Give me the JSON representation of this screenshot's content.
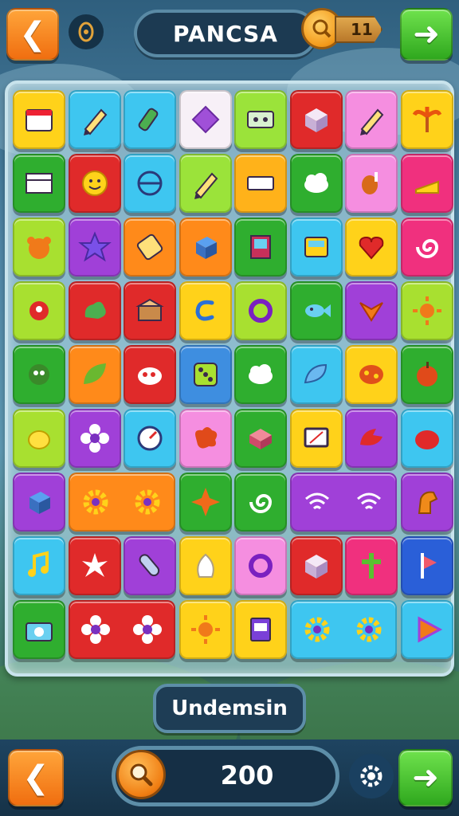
{
  "header": {
    "title": "PANCSA",
    "coin_count": "11",
    "back_icon": "arrow-left-icon",
    "next_icon": "arrow-right-icon",
    "badge_icon": "ornament-badge-icon"
  },
  "board": {
    "tiles": [
      {
        "icon": "calendar-icon",
        "color": "#ffd21a"
      },
      {
        "icon": "pencil-icon",
        "color": "#3ec6f0"
      },
      {
        "icon": "marker-icon",
        "color": "#3ec6f0"
      },
      {
        "icon": "diamond-icon",
        "color": "#f7f0f7"
      },
      {
        "icon": "cassette-icon",
        "color": "#9be33a"
      },
      {
        "icon": "box-icon",
        "color": "#e02a2a"
      },
      {
        "icon": "pencil-icon",
        "color": "#f58ee0"
      },
      {
        "icon": "palm-tree-icon",
        "color": "#ffd21a"
      },
      {
        "icon": "window-icon",
        "color": "#2fae2f"
      },
      {
        "icon": "smiley-icon",
        "color": "#e02a2a"
      },
      {
        "icon": "fan-icon",
        "color": "#3ec6f0"
      },
      {
        "icon": "pencil-icon",
        "color": "#9be33a"
      },
      {
        "icon": "ticket-icon",
        "color": "#ffb21a"
      },
      {
        "icon": "cloud-icon",
        "color": "#2fae2f"
      },
      {
        "icon": "drumstick-icon",
        "color": "#f58ee0"
      },
      {
        "icon": "cheese-icon",
        "color": "#f0307e"
      },
      {
        "icon": "bear-icon",
        "color": "#a8e030"
      },
      {
        "icon": "star-icon",
        "color": "#a040d8"
      },
      {
        "icon": "battery-icon",
        "color": "#ff8a1a"
      },
      {
        "icon": "cube-icon",
        "color": "#ff8a1a"
      },
      {
        "icon": "book-icon",
        "color": "#2fae2f"
      },
      {
        "icon": "radio-icon",
        "color": "#3ec6f0"
      },
      {
        "icon": "heart-icon",
        "color": "#ffd21a"
      },
      {
        "icon": "swirl-icon",
        "color": "#f0307e"
      },
      {
        "icon": "bird-icon",
        "color": "#a8e030"
      },
      {
        "icon": "blob-icon",
        "color": "#e02a2a"
      },
      {
        "icon": "treasure-icon",
        "color": "#e02a2a"
      },
      {
        "icon": "spiral-icon",
        "color": "#ffd21a"
      },
      {
        "icon": "ring-icon",
        "color": "#a8e030"
      },
      {
        "icon": "fish-icon",
        "color": "#2fae2f"
      },
      {
        "icon": "phoenix-icon",
        "color": "#a040d8"
      },
      {
        "icon": "sun-icon",
        "color": "#a8e030"
      },
      {
        "icon": "monster-icon",
        "color": "#2fae2f"
      },
      {
        "icon": "leaf-icon",
        "color": "#ff8a1a"
      },
      {
        "icon": "cloud-dots-icon",
        "color": "#e02a2a"
      },
      {
        "icon": "dice-icon",
        "color": "#3e8ee0"
      },
      {
        "icon": "cloud-icon",
        "color": "#2fae2f"
      },
      {
        "icon": "shell-icon",
        "color": "#3ec6f0"
      },
      {
        "icon": "pizza-icon",
        "color": "#ffd21a"
      },
      {
        "icon": "apple-icon",
        "color": "#2fae2f"
      },
      {
        "icon": "lemon-icon",
        "color": "#a8e030"
      },
      {
        "icon": "flower-icon",
        "color": "#a040d8"
      },
      {
        "icon": "dial-icon",
        "color": "#3ec6f0"
      },
      {
        "icon": "splat-icon",
        "color": "#f58ee0"
      },
      {
        "icon": "chest-icon",
        "color": "#2fae2f"
      },
      {
        "icon": "monitor-icon",
        "color": "#ffd21a"
      },
      {
        "icon": "dragon-icon",
        "color": "#a040d8"
      },
      {
        "icon": "tomato-icon",
        "color": "#3ec6f0"
      },
      {
        "icon": "cube-icon",
        "color": "#a040d8"
      },
      {
        "icon": "gear-icon",
        "color": "#ff8a1a",
        "wide": true
      },
      {
        "icon": "star4-icon",
        "color": "#2fae2f"
      },
      {
        "icon": "swirl-icon",
        "color": "#2fae2f"
      },
      {
        "icon": "wifi-icon",
        "color": "#a040d8",
        "wide": true
      },
      {
        "icon": "horse-icon",
        "color": "#a040d8"
      },
      {
        "icon": "music-note-icon",
        "color": "#3ec6f0"
      },
      {
        "icon": "splash-icon",
        "color": "#e02a2a"
      },
      {
        "icon": "rocket-icon",
        "color": "#a040d8"
      },
      {
        "icon": "garlic-icon",
        "color": "#ffd21a"
      },
      {
        "icon": "ring-icon",
        "color": "#f58ee0"
      },
      {
        "icon": "box-icon",
        "color": "#e02a2a"
      },
      {
        "icon": "cross-icon",
        "color": "#f0307e"
      },
      {
        "icon": "flag-icon",
        "color": "#2a5fd8"
      },
      {
        "icon": "camera-icon",
        "color": "#2fae2f"
      },
      {
        "icon": "flower-icon",
        "color": "#e02a2a",
        "wide": true
      },
      {
        "icon": "sun-icon",
        "color": "#ffd21a"
      },
      {
        "icon": "notebook-icon",
        "color": "#ffd21a"
      },
      {
        "icon": "gear-icon",
        "color": "#3ec6f0",
        "wide": true
      },
      {
        "icon": "play-icon",
        "color": "#3ec6f0"
      }
    ]
  },
  "footer": {
    "label": "Undemsin",
    "score": "200",
    "back_icon": "arrow-left-icon",
    "next_icon": "arrow-right-icon",
    "settings_icon": "gear-icon",
    "search_icon": "magnifier-icon"
  }
}
